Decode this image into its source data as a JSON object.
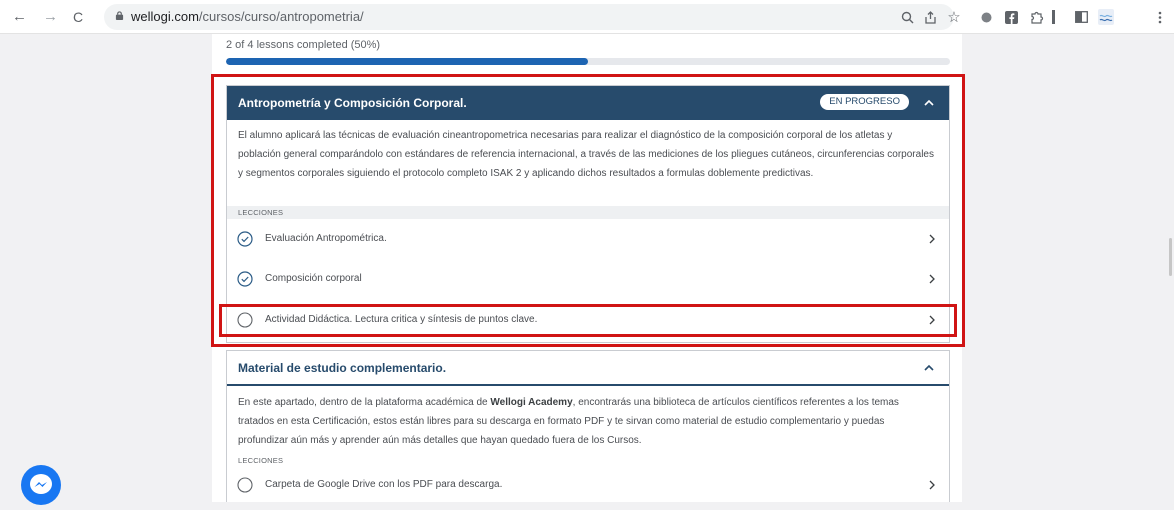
{
  "browser": {
    "back": "←",
    "forward": "→",
    "reload": "C",
    "url_domain": "wellogi.com",
    "url_path": "/cursos/curso/antropometria/"
  },
  "progress": {
    "label": "2 of 4 lessons completed (50%)",
    "percent": 50
  },
  "card1": {
    "title": "Antropometría y Composición Corporal.",
    "badge": "EN PROGRESO",
    "description": "El alumno aplicará las técnicas de evaluación cineantropometrica necesarias para realizar el diagnóstico de la composición corporal de los atletas y población general comparándolo con estándares de referencia internacional, a través de las mediciones de los pliegues cutáneos, circunferencias corporales y segmentos corporales siguiendo el protocolo completo ISAK 2 y aplicando dichos resultados a formulas doblemente predictivas.",
    "section_label": "LECCIONES",
    "lessons": [
      {
        "label": "Evaluación Antropométrica.",
        "completed": true
      },
      {
        "label": "Composición corporal",
        "completed": true
      },
      {
        "label": "Actividad Didáctica. Lectura critica y síntesis de puntos clave.",
        "completed": false
      }
    ]
  },
  "card2": {
    "title": "Material de estudio complementario.",
    "desc_before": "En este apartado, dentro de la plataforma académica de ",
    "desc_bold": "Wellogi Academy",
    "desc_after": ", encontrarás una biblioteca de artículos científicos referentes a los temas tratados en esta Certificación, estos están libres para su descarga en formato PDF y te sirvan como material de estudio complementario y puedas profundizar aún más y aprender aún más detalles que hayan quedado fuera de los Cursos.",
    "section_label": "LECCIONES",
    "lessons": [
      {
        "label": "Carpeta de Google Drive con los PDF para descarga.",
        "completed": false
      }
    ]
  },
  "colors": {
    "header_bg": "#274b6c",
    "progress_fill": "#1d64b2",
    "highlight": "#d01414",
    "check": "#2a5b86"
  }
}
